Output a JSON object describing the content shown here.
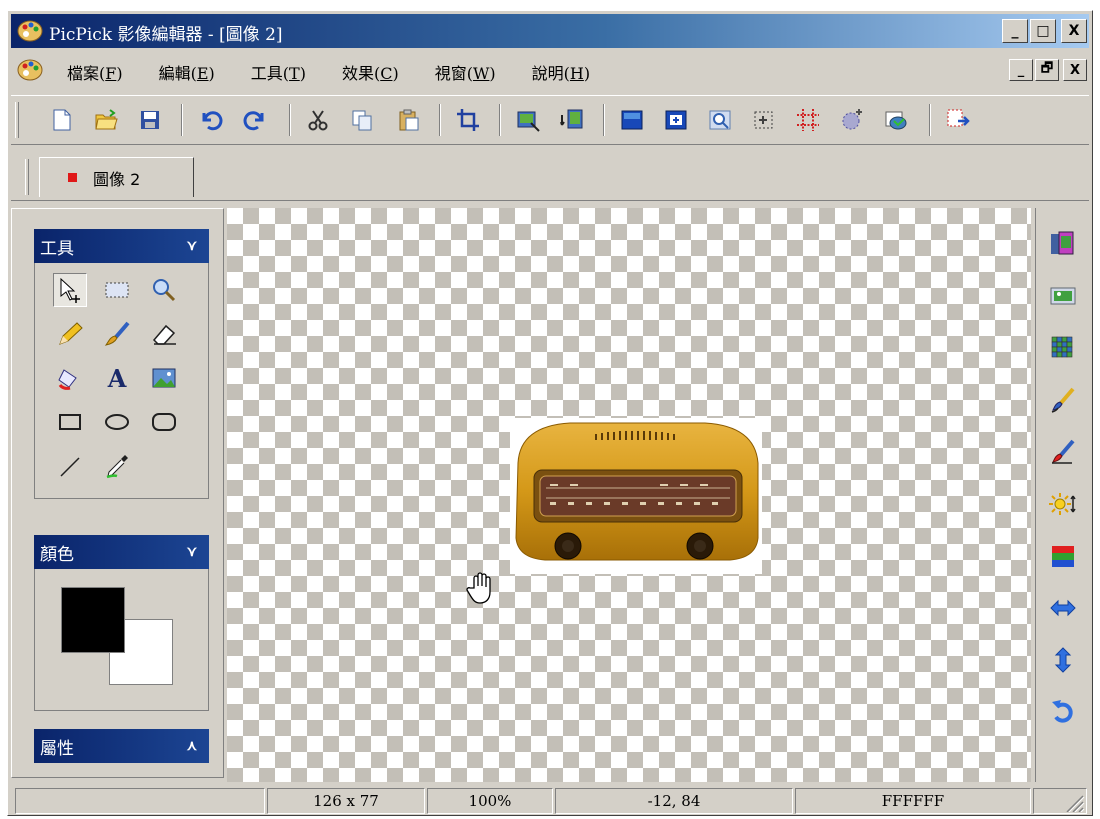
{
  "window": {
    "title": "PicPick 影像編輯器 - [圖像 2]",
    "controls": {
      "minimize": "_",
      "maximize": "□",
      "close": "X"
    }
  },
  "menubar": {
    "items": [
      {
        "label": "檔案(",
        "key": "F",
        "suffix": ")"
      },
      {
        "label": "編輯(",
        "key": "E",
        "suffix": ")"
      },
      {
        "label": "工具(",
        "key": "T",
        "suffix": ")"
      },
      {
        "label": "效果(",
        "key": "C",
        "suffix": ")"
      },
      {
        "label": "視窗(",
        "key": "W",
        "suffix": ")"
      },
      {
        "label": "說明(",
        "key": "H",
        "suffix": ")"
      }
    ],
    "mdi_controls": {
      "minimize": "_",
      "restore": "🗗",
      "close": "X"
    }
  },
  "toolbar": {
    "buttons": [
      "new-icon",
      "open-icon",
      "save-icon",
      "undo-icon",
      "redo-icon",
      "cut-icon",
      "copy-icon",
      "paste-icon",
      "crop-icon",
      "resize-icon",
      "rotate-icon",
      "frame-icon",
      "add-icon",
      "zoom-icon",
      "select-icon",
      "grid-icon",
      "effects-icon",
      "capture-icon",
      "export-icon"
    ]
  },
  "tabs": [
    {
      "label": "圖像 2",
      "active": true
    }
  ],
  "panels": {
    "tools": {
      "title": "工具",
      "chevron": "⌄"
    },
    "color": {
      "title": "顏色",
      "chevron": "⌄",
      "foreground": "#000000",
      "background": "#FFFFFF"
    },
    "properties": {
      "title": "屬性",
      "chevron": "⌃"
    }
  },
  "tools": [
    "pointer-tool",
    "rect-select-tool",
    "zoom-tool",
    "pencil-tool",
    "brush-tool",
    "eraser-tool",
    "fill-tool",
    "text-tool",
    "image-tool",
    "rectangle-tool",
    "ellipse-tool",
    "rounded-rect-tool",
    "line-tool",
    "eyedropper-tool"
  ],
  "statusbar": {
    "cells": [
      "",
      "126 x 77",
      "100%",
      "-12, 84",
      "FFFFFF"
    ]
  },
  "colors": {
    "title_start": "#0a246a",
    "title_end": "#a6caf0",
    "chrome": "#d4d0c8",
    "checker": "#c3bfb7"
  }
}
